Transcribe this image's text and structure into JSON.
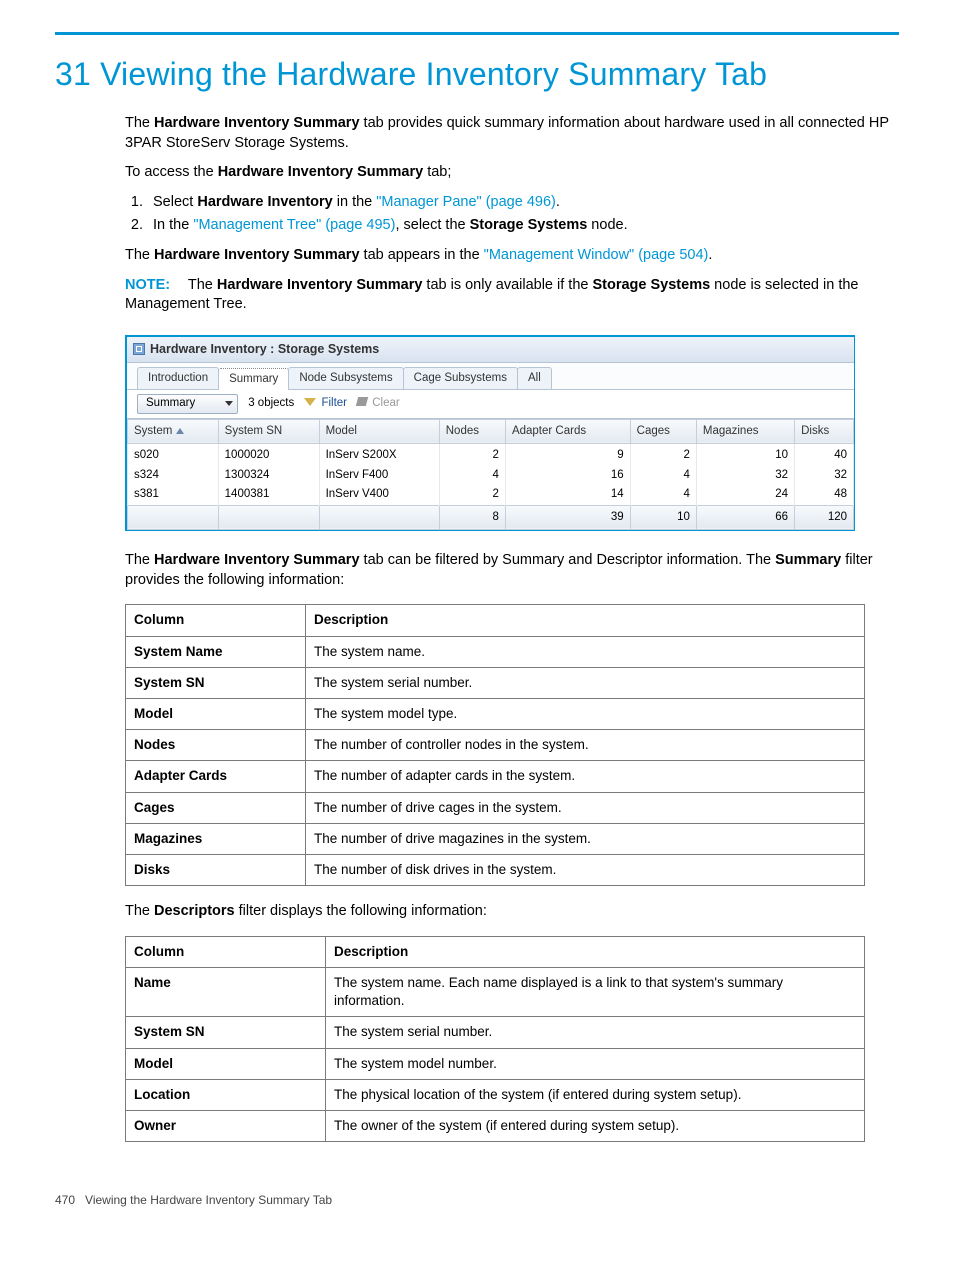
{
  "title": "31 Viewing the Hardware Inventory Summary Tab",
  "intro": {
    "p1a": "The ",
    "p1b": "Hardware Inventory Summary",
    "p1c": " tab provides quick summary information about hardware used in all connected HP 3PAR StoreServ Storage Systems.",
    "p2a": "To access the ",
    "p2b": "Hardware Inventory Summary",
    "p2c": " tab;"
  },
  "steps": {
    "s1a": "Select ",
    "s1b": "Hardware Inventory",
    "s1c": " in the ",
    "s1d": "\"Manager Pane\" (page 496)",
    "s1e": ".",
    "s2a": "In the ",
    "s2b": "\"Management Tree\" (page 495)",
    "s2c": ", select the ",
    "s2d": "Storage Systems",
    "s2e": " node."
  },
  "after_steps": {
    "p3a": "The ",
    "p3b": "Hardware Inventory Summary",
    "p3c": " tab appears in the ",
    "p3d": "\"Management Window\" (page 504)",
    "p3e": "."
  },
  "note": {
    "label": "NOTE:",
    "a": "The ",
    "b": "Hardware Inventory Summary",
    "c": " tab is only available if the ",
    "d": "Storage Systems",
    "e": " node is selected in the Management Tree."
  },
  "screenshot": {
    "title": "Hardware Inventory : Storage Systems",
    "tabs": [
      "Introduction",
      "Summary",
      "Node Subsystems",
      "Cage Subsystems",
      "All"
    ],
    "selected_tab": 1,
    "toolbar": {
      "dropdown": "Summary",
      "objects": "3 objects",
      "filter": "Filter",
      "clear": "Clear"
    },
    "columns": [
      "System",
      "System SN",
      "Model",
      "Nodes",
      "Adapter Cards",
      "Cages",
      "Magazines",
      "Disks"
    ],
    "rows": [
      {
        "system": "s020",
        "sn": "1000020",
        "model": "InServ S200X",
        "nodes": "2",
        "adapter": "9",
        "cages": "2",
        "mags": "10",
        "disks": "40"
      },
      {
        "system": "s324",
        "sn": "1300324",
        "model": "InServ F400",
        "nodes": "4",
        "adapter": "16",
        "cages": "4",
        "mags": "32",
        "disks": "32"
      },
      {
        "system": "s381",
        "sn": "1400381",
        "model": "InServ V400",
        "nodes": "2",
        "adapter": "14",
        "cages": "4",
        "mags": "24",
        "disks": "48"
      }
    ],
    "footer": {
      "nodes": "8",
      "adapter": "39",
      "cages": "10",
      "mags": "66",
      "disks": "120"
    }
  },
  "mid": {
    "p4a": "The ",
    "p4b": "Hardware Inventory Summary",
    "p4c": " tab can be filtered by Summary and Descriptor information. The ",
    "p4d": "Summary",
    "p4e": " filter provides the following information:"
  },
  "table1": {
    "h1": "Column",
    "h2": "Description",
    "rows": [
      {
        "c": "System Name",
        "d": "The system name."
      },
      {
        "c": "System SN",
        "d": "The system serial number."
      },
      {
        "c": "Model",
        "d": "The system model type."
      },
      {
        "c": "Nodes",
        "d": "The number of controller nodes in the system."
      },
      {
        "c": "Adapter Cards",
        "d": "The number of adapter cards in the system."
      },
      {
        "c": "Cages",
        "d": "The number of drive cages in the system."
      },
      {
        "c": "Magazines",
        "d": "The number of drive magazines in the system."
      },
      {
        "c": "Disks",
        "d": "The number of disk drives in the system."
      }
    ]
  },
  "mid2": {
    "p5a": "The ",
    "p5b": "Descriptors",
    "p5c": " filter displays the following information:"
  },
  "table2": {
    "h1": "Column",
    "h2": "Description",
    "rows": [
      {
        "c": "Name",
        "d": "The system name. Each name displayed is a link to that system's summary information."
      },
      {
        "c": "System SN",
        "d": "The system serial number."
      },
      {
        "c": "Model",
        "d": "The system model number."
      },
      {
        "c": "Location",
        "d": "The physical location of the system (if entered during system setup)."
      },
      {
        "c": "Owner",
        "d": "The owner of the system (if entered during system setup)."
      }
    ]
  },
  "footer": {
    "pageno": "470",
    "caption": "Viewing the Hardware Inventory Summary Tab"
  }
}
